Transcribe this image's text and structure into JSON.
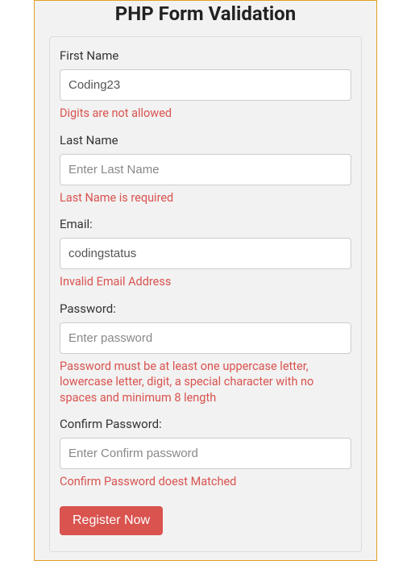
{
  "title": "PHP Form Validation",
  "fields": {
    "first_name": {
      "label": "First Name",
      "value": "Coding23",
      "placeholder": "",
      "error": "Digits are not allowed"
    },
    "last_name": {
      "label": "Last Name",
      "value": "",
      "placeholder": "Enter Last Name",
      "error": "Last Name is required"
    },
    "email": {
      "label": "Email:",
      "value": "codingstatus",
      "placeholder": "",
      "error": "Invalid Email Address"
    },
    "password": {
      "label": "Password:",
      "value": "",
      "placeholder": "Enter password",
      "error": "Password must be at least one uppercase letter, lowercase letter, digit, a special character with no spaces and minimum 8 length"
    },
    "confirm_password": {
      "label": "Confirm Password:",
      "value": "",
      "placeholder": "Enter Confirm password",
      "error": "Confirm Password doest Matched"
    }
  },
  "submit_label": "Register Now"
}
